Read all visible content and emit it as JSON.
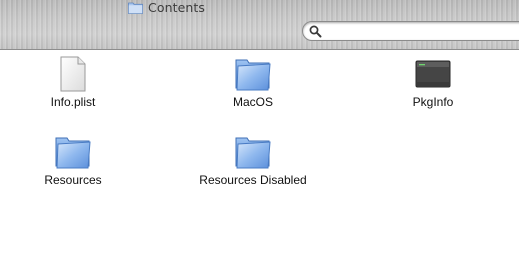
{
  "window": {
    "title": "Contents"
  },
  "search": {
    "value": "",
    "placeholder": ""
  },
  "items": [
    {
      "label": "Info.plist",
      "icon": "document-icon"
    },
    {
      "label": "MacOS",
      "icon": "folder-icon"
    },
    {
      "label": "PkgInfo",
      "icon": "terminal-icon"
    },
    {
      "label": "Resources",
      "icon": "folder-icon"
    },
    {
      "label": "Resources Disabled",
      "icon": "folder-icon"
    }
  ],
  "colors": {
    "folder_blue": "#6f9fe0",
    "toolbar_gray": "#c6c6c6"
  }
}
